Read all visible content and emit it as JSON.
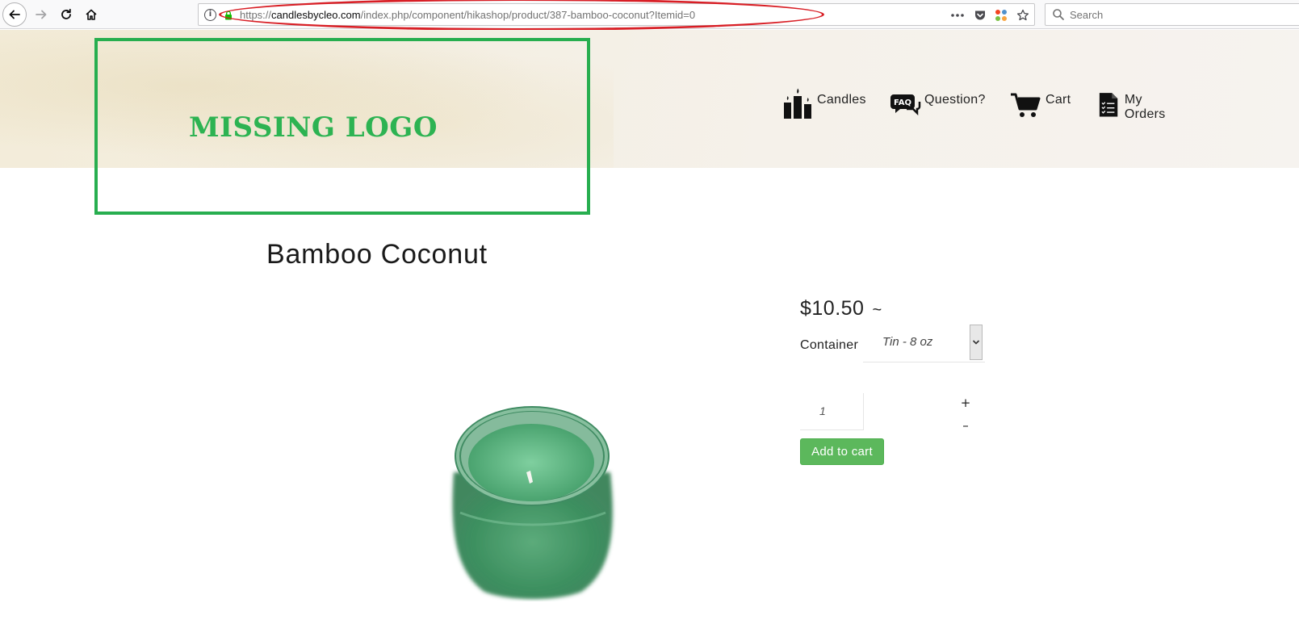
{
  "browser": {
    "url_prefix": "https://",
    "url_host": "candlesbycleo.com",
    "url_path": "/index.php/component/hikashop/product/387-bamboo-coconut?Itemid=0",
    "search_placeholder": "Search",
    "annotation_color": "#d81e25"
  },
  "header": {
    "logo_text": "MISSING LOGO",
    "logo_frame_color": "#27ae4f",
    "menu": [
      {
        "label": "Candles",
        "icon": "candles-icon"
      },
      {
        "label": "Question?",
        "icon": "faq-icon"
      },
      {
        "label": "Cart",
        "icon": "cart-icon"
      },
      {
        "label": "My Orders",
        "icon": "orders-icon"
      }
    ]
  },
  "product": {
    "title": "Bamboo Coconut",
    "price": "$10.50",
    "price_suffix": "~",
    "container_label": "Container",
    "container_value": "Tin - 8 oz",
    "quantity": "1",
    "plus_label": "+",
    "minus_label": "–",
    "add_to_cart_label": "Add to cart",
    "button_color": "#5cb85c",
    "image": "green-candle-jar"
  }
}
